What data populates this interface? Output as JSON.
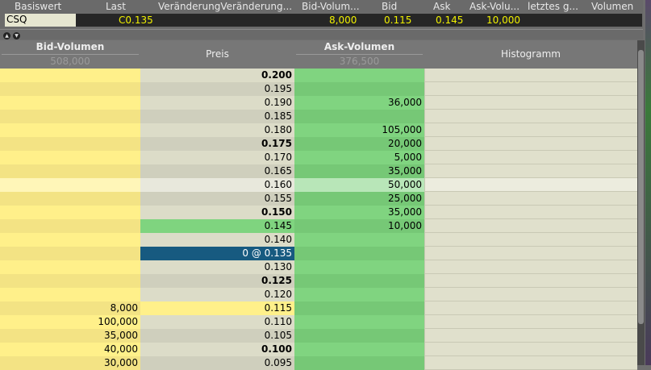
{
  "header": {
    "columns": [
      "Basiswert",
      "Last",
      "VeränderungVeränderung...",
      "Bid-Volum...",
      "Bid",
      "Ask",
      "Ask-Volu...",
      "letztes g...",
      "Volumen"
    ],
    "values": {
      "symbol": "CSQ",
      "last": "C0.135",
      "bid_volume": "8,000",
      "bid": "0.115",
      "ask": "0.145",
      "ask_volume": "10,000"
    }
  },
  "book": {
    "bid_volume_label": "Bid-Volumen",
    "bid_volume_total": "508,000",
    "price_label": "Preis",
    "ask_volume_label": "Ask-Volumen",
    "ask_volume_total": "376,500",
    "histogram_label": "Histogramm",
    "rows": [
      {
        "price": "0.200",
        "bid": "",
        "ask": "",
        "bold": true
      },
      {
        "price": "0.195",
        "bid": "",
        "ask": ""
      },
      {
        "price": "0.190",
        "bid": "",
        "ask": "36,000"
      },
      {
        "price": "0.185",
        "bid": "",
        "ask": ""
      },
      {
        "price": "0.180",
        "bid": "",
        "ask": "105,000"
      },
      {
        "price": "0.175",
        "bid": "",
        "ask": "20,000",
        "bold": true
      },
      {
        "price": "0.170",
        "bid": "",
        "ask": "5,000"
      },
      {
        "price": "0.165",
        "bid": "",
        "ask": "35,000"
      },
      {
        "price": "0.160",
        "bid": "",
        "ask": "50,000",
        "hover": true
      },
      {
        "price": "0.155",
        "bid": "",
        "ask": "25,000"
      },
      {
        "price": "0.150",
        "bid": "",
        "ask": "35,000",
        "bold": true
      },
      {
        "price": "0.145",
        "bid": "",
        "ask": "10,000",
        "best": "ask"
      },
      {
        "price": "0.140",
        "bid": "",
        "ask": ""
      },
      {
        "price": "0 @ 0.135",
        "bid": "",
        "ask": "",
        "best": "last"
      },
      {
        "price": "0.130",
        "bid": "",
        "ask": ""
      },
      {
        "price": "0.125",
        "bid": "",
        "ask": "",
        "bold": true
      },
      {
        "price": "0.120",
        "bid": "",
        "ask": ""
      },
      {
        "price": "0.115",
        "bid": "8,000",
        "ask": "",
        "best": "bid"
      },
      {
        "price": "0.110",
        "bid": "100,000",
        "ask": ""
      },
      {
        "price": "0.105",
        "bid": "35,000",
        "ask": ""
      },
      {
        "price": "0.100",
        "bid": "40,000",
        "ask": "",
        "bold": true
      },
      {
        "price": "0.095",
        "bid": "30,000",
        "ask": ""
      }
    ]
  },
  "colors": {
    "bid": "#fff08a",
    "ask": "#7fd47f",
    "last": "#175a80"
  }
}
